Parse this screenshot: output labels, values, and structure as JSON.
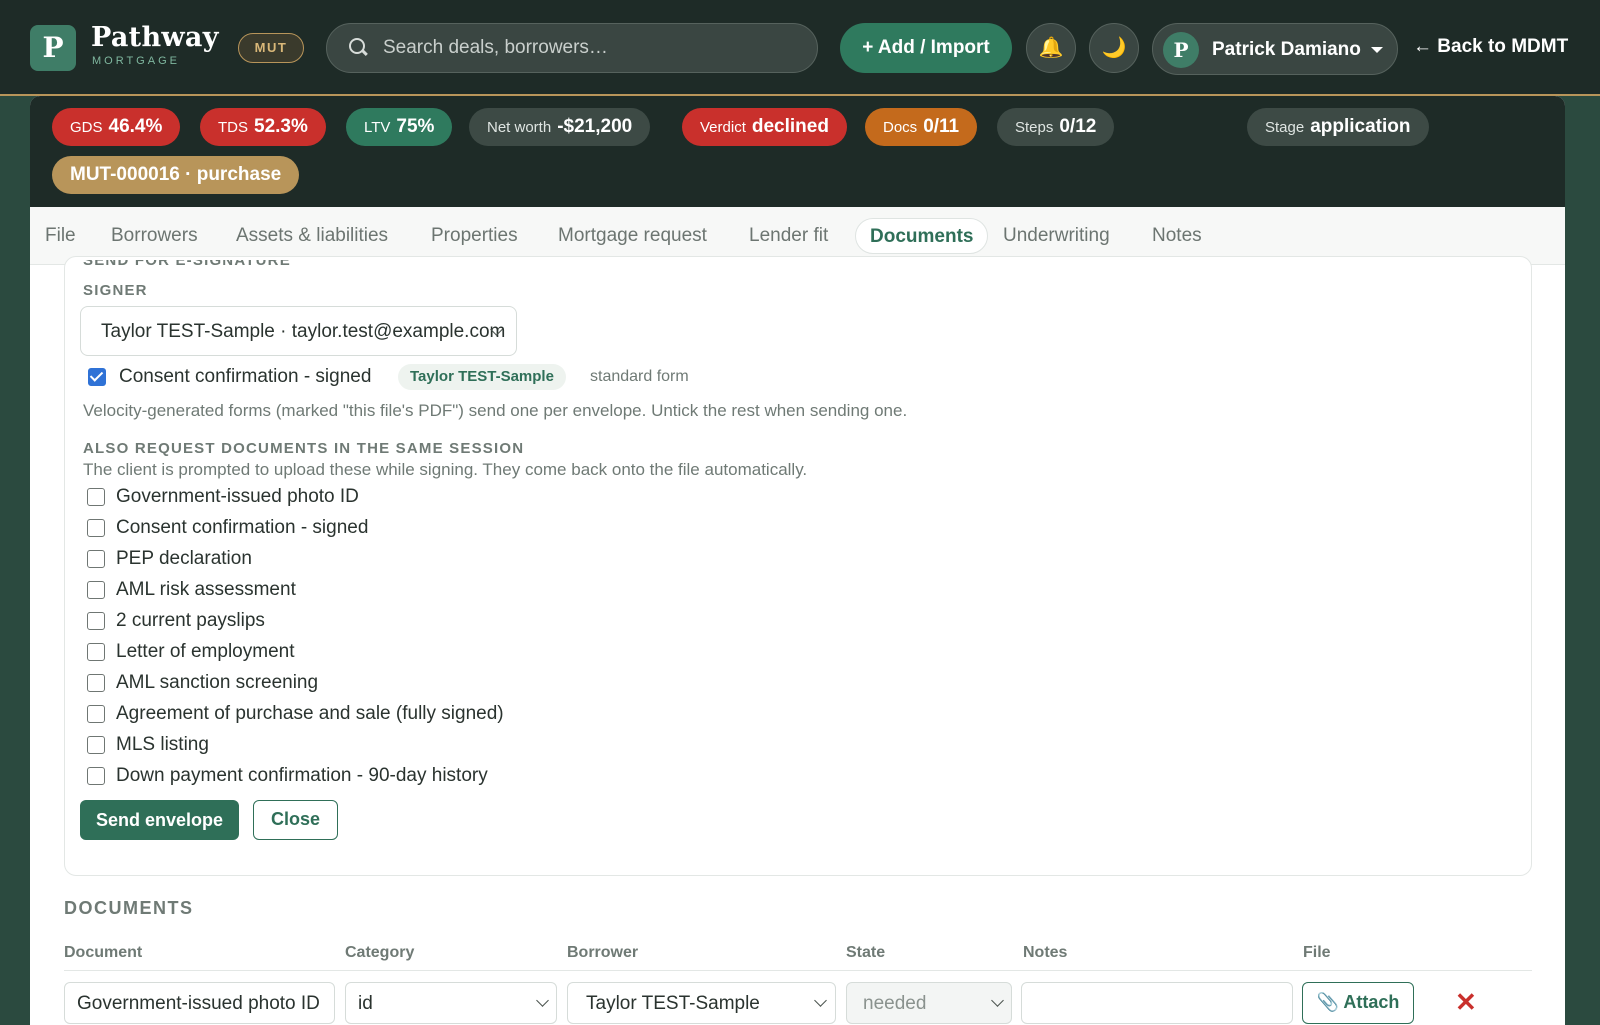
{
  "topbar": {
    "logo_letter": "P",
    "brand_name": "Pathway",
    "brand_sub": "MORTGAGE",
    "env_badge": "MUT",
    "search_placeholder": "Search deals, borrowers…",
    "add_button": "+ Add / Import",
    "bell_icon": "🔔",
    "moon_icon": "🌙",
    "user_initial": "P",
    "user_name": "Patrick Damiano",
    "back_link": "← Back to MDMT"
  },
  "metrics": [
    {
      "label": "GDS",
      "value": "46.4%"
    },
    {
      "label": "TDS",
      "value": "52.3%"
    },
    {
      "label": "LTV",
      "value": "75%"
    },
    {
      "label": "Net worth",
      "value": "-$21,200"
    },
    {
      "label": "Verdict",
      "value": "declined"
    },
    {
      "label": "Docs",
      "value": "0/11"
    },
    {
      "label": "Steps",
      "value": "0/12"
    },
    {
      "label": "Stage",
      "value": "application"
    }
  ],
  "file_chip": "MUT-000016 · purchase",
  "tabs": [
    "File",
    "Borrowers",
    "Assets & liabilities",
    "Properties",
    "Mortgage request",
    "Lender fit",
    "Documents",
    "Underwriting",
    "Notes"
  ],
  "esign": {
    "section_title": "SEND FOR E-SIGNATURE",
    "signer_label": "SIGNER",
    "signer_value": "Taylor TEST-Sample · taylor.test@example.com",
    "consent_label": "Consent confirmation - signed",
    "consent_signer": "Taylor TEST-Sample",
    "consent_form": "standard form",
    "velocity_hint": "Velocity-generated forms (marked \"this file's PDF\") send one per envelope. Untick the rest when sending one.",
    "also_title": "ALSO REQUEST DOCUMENTS IN THE SAME SESSION",
    "also_hint": "The client is prompted to upload these while signing. They come back onto the file automatically.",
    "documents": [
      "Government-issued photo ID",
      "Consent confirmation - signed",
      "PEP declaration",
      "AML risk assessment",
      "2 current payslips",
      "Letter of employment",
      "AML sanction screening",
      "Agreement of purchase and sale (fully signed)",
      "MLS listing",
      "Down payment confirmation - 90-day history"
    ],
    "send_button": "Send envelope",
    "close_button": "Close"
  },
  "documents_table": {
    "title": "DOCUMENTS",
    "headers": [
      "Document",
      "Category",
      "Borrower",
      "State",
      "Notes",
      "File"
    ],
    "row": {
      "document": "Government-issued photo ID",
      "category": "id",
      "borrower": "Taylor TEST-Sample",
      "state": "needed",
      "notes": "",
      "attach": "📎 Attach",
      "remove": "✕"
    }
  }
}
